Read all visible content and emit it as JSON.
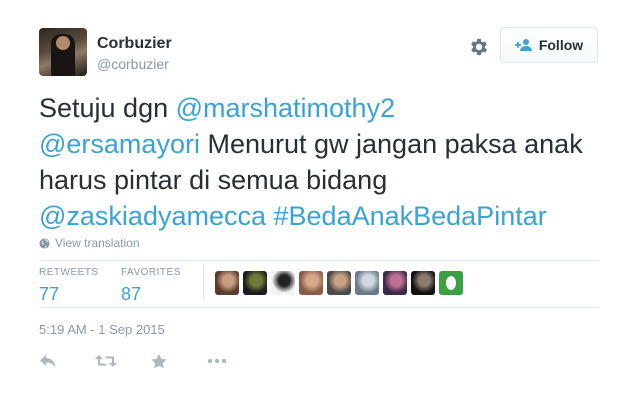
{
  "user": {
    "fullname": "Corbuzier",
    "username": "@corbuzier"
  },
  "follow_button": {
    "label": "Follow"
  },
  "tweet": {
    "parts": [
      {
        "text": "Setuju dgn ",
        "type": "text"
      },
      {
        "text": "@marshatimothy2",
        "type": "mention"
      },
      {
        "text": "@ersamayori",
        "type": "mention"
      },
      {
        "text": " Menurut gw jangan paksa anak harus pintar di semua bidang ",
        "type": "text"
      },
      {
        "text": "@zaskiadyamecca",
        "type": "mention"
      },
      {
        "text": " ",
        "type": "text"
      },
      {
        "text": "#BedaAnakBedaPintar",
        "type": "hashtag"
      }
    ]
  },
  "view_translation": "View translation",
  "stats": {
    "retweets_label": "RETWEETS",
    "retweets_value": "77",
    "favorites_label": "FAVORITES",
    "favorites_value": "87"
  },
  "favoriter_avatars": [
    {
      "name": "favoriter-avatar-1",
      "colors": [
        "#5a3b2e",
        "#c99d80"
      ]
    },
    {
      "name": "favoriter-avatar-2",
      "colors": [
        "#1c1c1c",
        "#6d7a3a"
      ]
    },
    {
      "name": "favoriter-avatar-3",
      "colors": [
        "#f3f3f3",
        "#222222"
      ]
    },
    {
      "name": "favoriter-avatar-4",
      "colors": [
        "#8a5a4a",
        "#d8a888"
      ]
    },
    {
      "name": "favoriter-avatar-5",
      "colors": [
        "#4a4a4a",
        "#c9a080"
      ]
    },
    {
      "name": "favoriter-avatar-6",
      "colors": [
        "#6a7a8a",
        "#d0d8e0"
      ]
    },
    {
      "name": "favoriter-avatar-7",
      "colors": [
        "#3a2a4a",
        "#c07090"
      ]
    },
    {
      "name": "favoriter-avatar-8",
      "colors": [
        "#111111",
        "#8a7a70"
      ]
    },
    {
      "name": "favoriter-avatar-9",
      "colors": [
        "#3aa040",
        "#ffffff"
      ]
    }
  ],
  "timestamp": "5:19 AM - 1 Sep 2015",
  "actions": [
    {
      "name": "reply-icon"
    },
    {
      "name": "retweet-icon"
    },
    {
      "name": "favorite-icon"
    },
    {
      "name": "more-icon"
    }
  ],
  "colors": {
    "link": "#3ba3d4",
    "muted": "#8899a6",
    "text": "#292f33",
    "border": "#e1e8ed"
  }
}
